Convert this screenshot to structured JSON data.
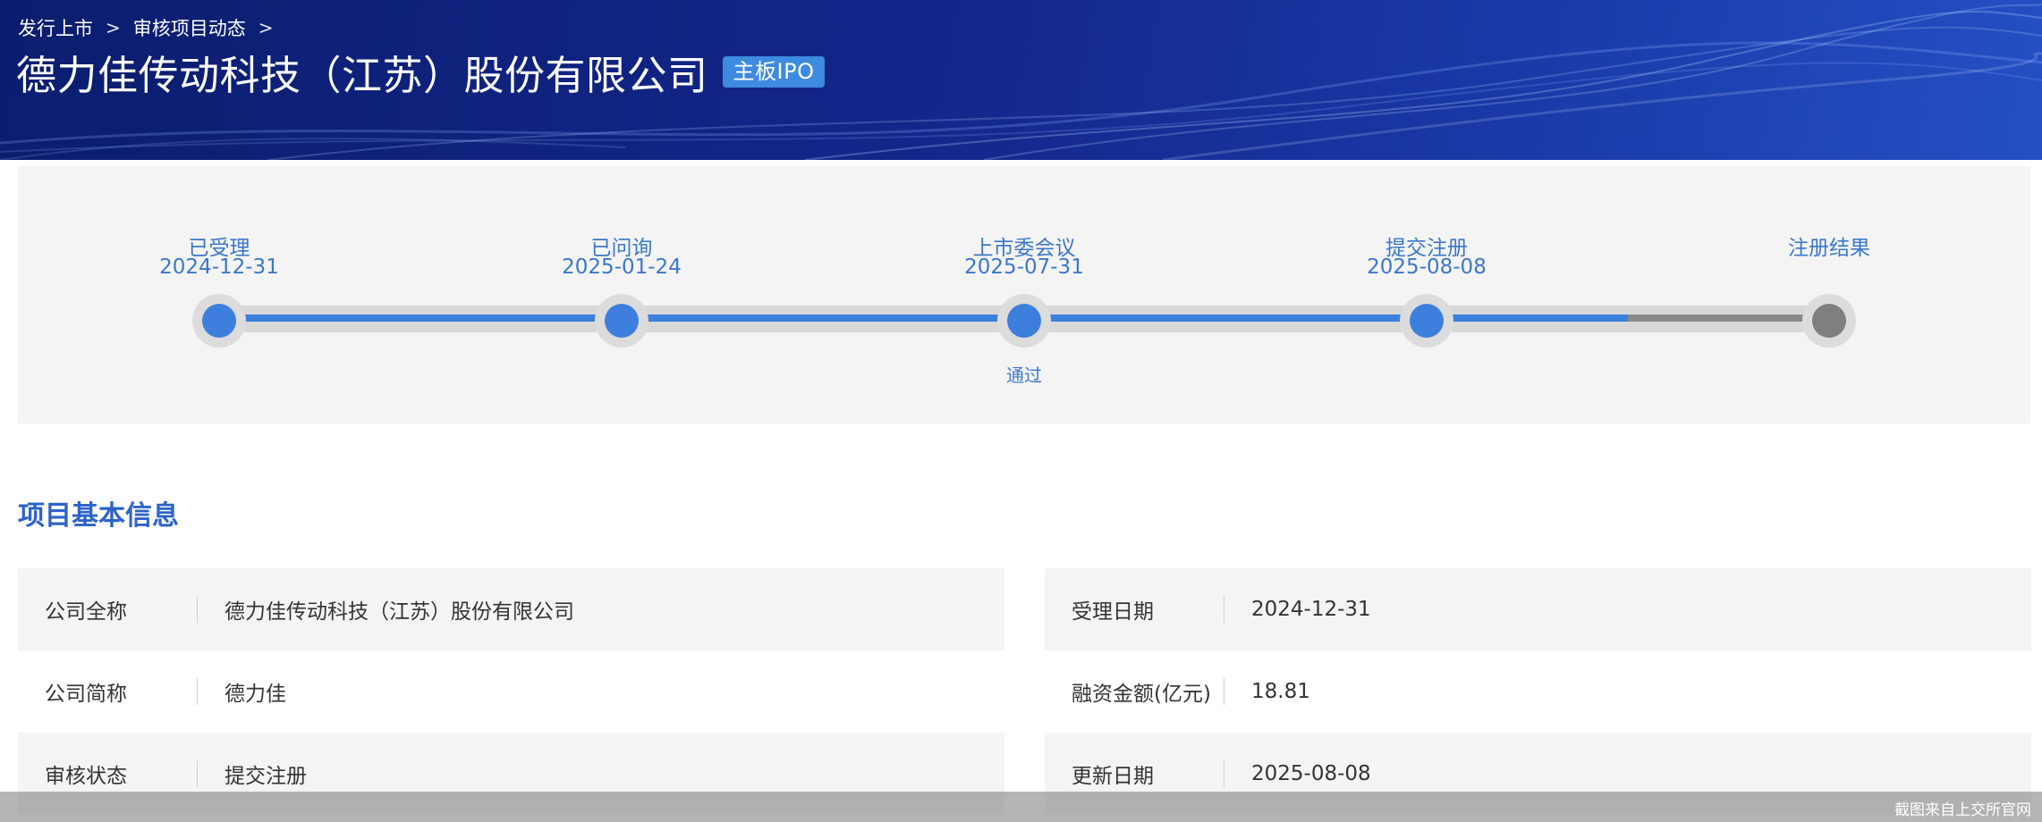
{
  "breadcrumb": {
    "items": [
      "发行上市",
      "审核项目动态"
    ],
    "separator": ">"
  },
  "header": {
    "title": "德力佳传动科技（江苏）股份有限公司",
    "badge": "主板IPO"
  },
  "progress": {
    "steps": [
      {
        "label": "已受理",
        "date": "2024-12-31",
        "status": "done",
        "note": ""
      },
      {
        "label": "已问询",
        "date": "2025-01-24",
        "status": "done",
        "note": ""
      },
      {
        "label": "上市委会议",
        "date": "2025-07-31",
        "status": "done",
        "note": "通过"
      },
      {
        "label": "提交注册",
        "date": "2025-08-08",
        "status": "done",
        "note": ""
      },
      {
        "label": "注册结果",
        "date": "",
        "status": "pending",
        "note": ""
      }
    ]
  },
  "section": {
    "title": "项目基本信息"
  },
  "info": {
    "left": [
      {
        "key": "公司全称",
        "value": "德力佳传动科技（江苏）股份有限公司"
      },
      {
        "key": "公司简称",
        "value": "德力佳"
      },
      {
        "key": "审核状态",
        "value": "提交注册"
      }
    ],
    "right": [
      {
        "key": "受理日期",
        "value": "2024-12-31"
      },
      {
        "key": "融资金额(亿元)",
        "value": "18.81"
      },
      {
        "key": "更新日期",
        "value": "2025-08-08"
      }
    ]
  },
  "footer": {
    "watermark": "截图来自上交所官网"
  },
  "colors": {
    "accent": "#3d7fdc",
    "banner": "#13268a",
    "pending": "#7f7f7f",
    "section_title": "#2d63c8"
  }
}
